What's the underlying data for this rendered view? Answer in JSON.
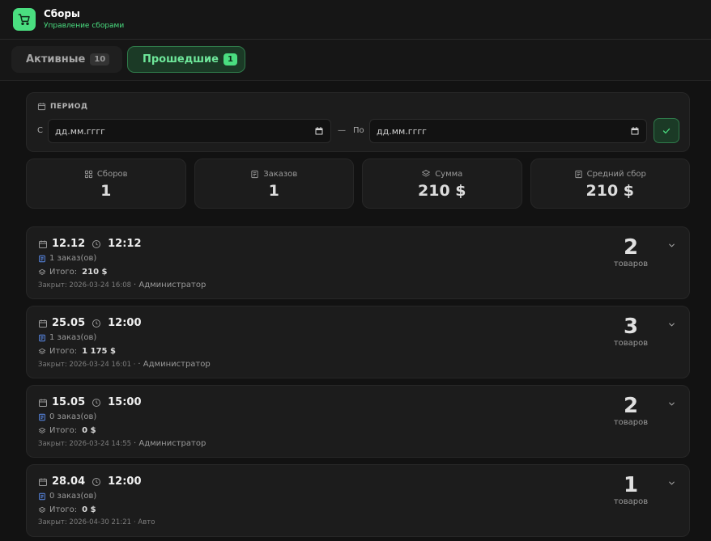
{
  "app": {
    "title": "Сборы",
    "subtitle": "Управление сборами",
    "brand_color": "#4ade80"
  },
  "tabs": [
    {
      "label": "Активные",
      "count": "10",
      "selected": false
    },
    {
      "label": "Прошедшие",
      "count": "1",
      "selected": true
    }
  ],
  "period": {
    "label": "ПЕРИОД",
    "from_label": "С",
    "separator": "—",
    "to_label": "По",
    "from_placeholder": "дд.мм.гггг",
    "to_placeholder": "дд.мм.гггг",
    "icons": {
      "period": "calendar-icon",
      "picker": "calendar-icon",
      "apply": "check-icon"
    }
  },
  "stats": [
    {
      "label": "Сборов",
      "value": "1",
      "icon": "grid-icon"
    },
    {
      "label": "Заказов",
      "value": "1",
      "icon": "document-icon"
    },
    {
      "label": "Сумма",
      "value": "210 $",
      "icon": "layers-icon"
    },
    {
      "label": "Средний сбор",
      "value": "210 $",
      "icon": "document-icon"
    }
  ],
  "collections": [
    {
      "date": "12.12",
      "time": "12:12",
      "orders": "1 заказ(ов)",
      "total_label": "Итого:",
      "total": "210 $",
      "closed": "Закрыт: 2026-03-24 16:08",
      "by": "· Администратор",
      "count": "2",
      "unit": "товаров"
    },
    {
      "date": "25.05",
      "time": "12:00",
      "orders": "1 заказ(ов)",
      "total_label": "Итого:",
      "total": "1 175 $",
      "closed": "Закрыт: 2026-03-24 16:01 ·",
      "by": "· Администратор",
      "count": "3",
      "unit": "товаров"
    },
    {
      "date": "15.05",
      "time": "15:00",
      "orders": "0 заказ(ов)",
      "total_label": "Итого:",
      "total": "0 $",
      "closed": "Закрыт: 2026-03-24 14:55",
      "by": "· Администратор",
      "count": "2",
      "unit": "товаров"
    },
    {
      "date": "28.04",
      "time": "12:00",
      "orders": "0 заказ(ов)",
      "total_label": "Итого:",
      "total": "0 $",
      "closed": "Закрыт: 2026-04-30 21:21",
      "by": "· Авто",
      "count": "1",
      "unit": "товаров"
    }
  ]
}
